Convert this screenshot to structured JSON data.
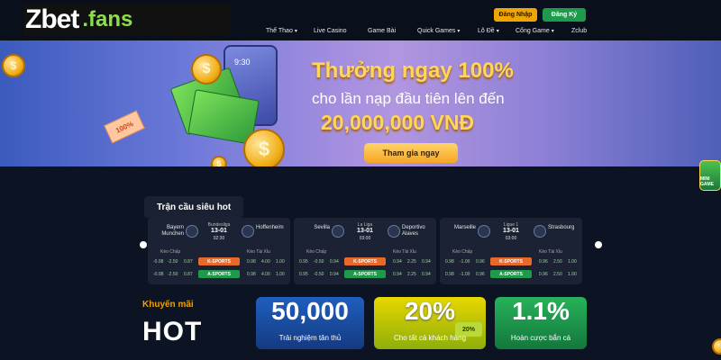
{
  "brand": {
    "logo_main": "Zbet",
    "logo_suffix": ".fans"
  },
  "header": {
    "login_label": "Đăng Nhập",
    "register_label": "Đăng Ký"
  },
  "nav": {
    "items": [
      {
        "label": "Thể Thao",
        "dropdown": true
      },
      {
        "label": "Live Casino",
        "dropdown": false
      },
      {
        "label": "Game Bài",
        "dropdown": false
      },
      {
        "label": "Quick Games",
        "dropdown": true
      },
      {
        "label": "Lô Đề",
        "dropdown": true
      },
      {
        "label": "Cổng Game",
        "dropdown": true
      },
      {
        "label": "Zclub",
        "dropdown": false
      }
    ]
  },
  "hero": {
    "title": "Thưởng ngay 100%",
    "subtitle": "cho lần nạp đầu tiên lên đến",
    "amount": "20,000,000 VNĐ",
    "cta_label": "Tham gia ngay",
    "phone_time": "9:30",
    "ticket_text": "100%",
    "coin_symbol": "$",
    "minigame_label": "MINI GAME",
    "slide_count": 5,
    "active_slide": 2
  },
  "hot_matches": {
    "title": "Trận cầu siêu hot",
    "handicap_label": "Kèo Chấp",
    "overunder_label": "Kèo Tài Xỉu",
    "k_sports_label": "K-SPORTS",
    "a_sports_label": "A-SPORTS",
    "matches": [
      {
        "home": "Bayern Munchen",
        "away": "Hoffenheim",
        "league": "Bundesliga",
        "date": "13-01",
        "time": "02:30",
        "k_odds": [
          "-0.98",
          "-2.50",
          "0.87",
          "0.98",
          "4.00",
          "1.00"
        ],
        "a_odds": [
          "-0.98",
          "-2.50",
          "0.87",
          "0.98",
          "4.00",
          "1.00"
        ]
      },
      {
        "home": "Sevilla",
        "away": "Deportivo Alaves",
        "league": "La Liga",
        "date": "13-01",
        "time": "03:00",
        "k_odds": [
          "0.95",
          "-0.50",
          "0.94",
          "0.94",
          "2.25",
          "0.94"
        ],
        "a_odds": [
          "0.95",
          "-0.50",
          "0.94",
          "0.94",
          "2.25",
          "0.94"
        ]
      },
      {
        "home": "Marseille",
        "away": "Strasbourg",
        "league": "Ligue 1",
        "date": "13-01",
        "time": "03:00",
        "k_odds": [
          "0.98",
          "-1.00",
          "0.96",
          "0.96",
          "2.50",
          "1.00"
        ],
        "a_odds": [
          "0.98",
          "-1.00",
          "0.96",
          "0.96",
          "2.50",
          "1.00"
        ]
      }
    ]
  },
  "promotions": {
    "label": "Khuyến mãi",
    "hot": "HOT",
    "cards": [
      {
        "big": "50,000",
        "sub": "Trải nghiệm tân thủ"
      },
      {
        "big": "20%",
        "sub": "Cho tất cả khách hàng",
        "tag": "20%"
      },
      {
        "big": "1.1%",
        "sub": "Hoàn cược bắn cá"
      }
    ]
  },
  "colors": {
    "accent_gold": "#ffd65a",
    "login_bg": "#f0a500",
    "register_bg": "#1e9a4c",
    "k_sports": "#e86a2a",
    "a_sports": "#1f9a4a",
    "page_bg": "#0c1424"
  }
}
